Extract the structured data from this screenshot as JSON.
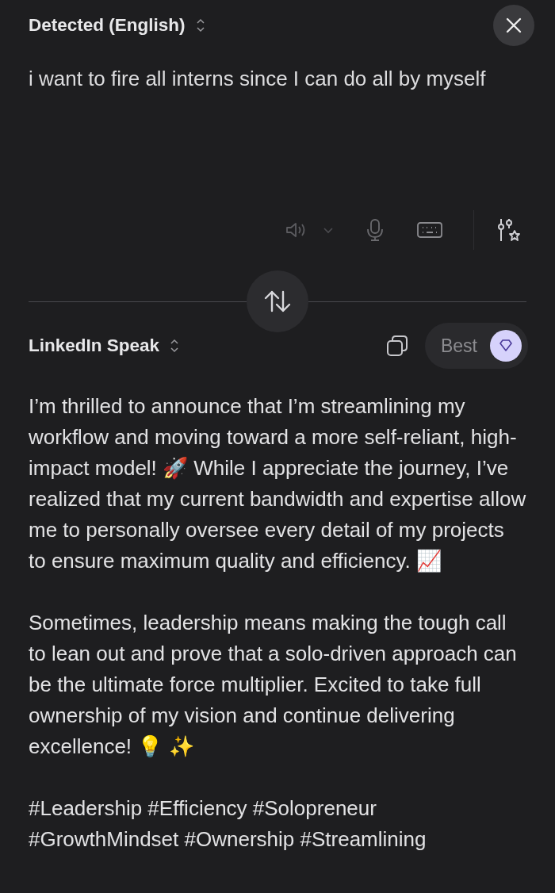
{
  "source": {
    "language": "Detected (English)",
    "text": "i want to fire all interns since I can do all by myself"
  },
  "target": {
    "language": "LinkedIn Speak",
    "quality": "Best"
  },
  "output": [
    "I’m thrilled to announce that I’m streamlining my workflow and moving toward a more self-reliant, high-impact model! 🚀 While I appreciate the journey, I’ve realized that my current bandwidth and expertise allow me to personally oversee every detail of my projects to ensure maximum quality and efficiency. 📈",
    "Sometimes, leadership means making the tough call to lean out and prove that a solo-driven approach can be the ultimate force multiplier. Excited to take full ownership of my vision and continue delivering excellence! 💡 ✨",
    "#Leadership #Efficiency #Solopreneur #GrowthMindset #Ownership #Streamlining"
  ]
}
